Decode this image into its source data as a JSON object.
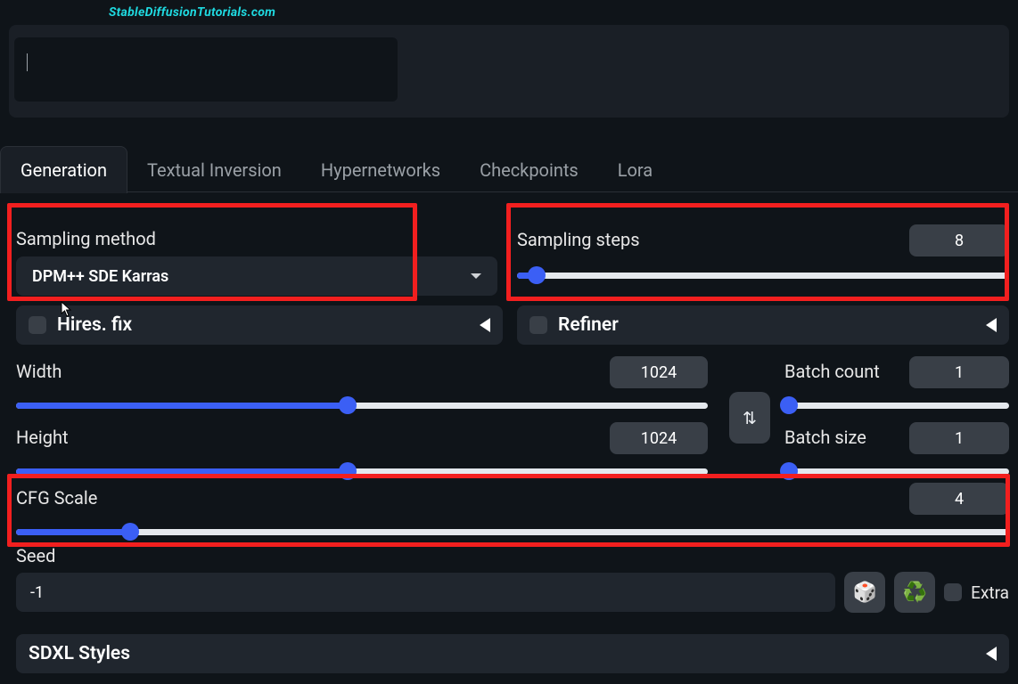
{
  "watermark": "StableDiffusionTutorials.com",
  "tabs": {
    "items": [
      {
        "label": "Generation",
        "active": true
      },
      {
        "label": "Textual Inversion",
        "active": false
      },
      {
        "label": "Hypernetworks",
        "active": false
      },
      {
        "label": "Checkpoints",
        "active": false
      },
      {
        "label": "Lora",
        "active": false
      }
    ]
  },
  "sampling_method": {
    "label": "Sampling method",
    "value": "DPM++ SDE Karras"
  },
  "sampling_steps": {
    "label": "Sampling steps",
    "value": 8,
    "min": 1,
    "max": 150,
    "fill_pct": 4
  },
  "hires_fix": {
    "label": "Hires. fix",
    "checked": false
  },
  "refiner": {
    "label": "Refiner",
    "checked": false
  },
  "width": {
    "label": "Width",
    "value": 1024,
    "min": 64,
    "max": 2048,
    "fill_pct": 48
  },
  "height": {
    "label": "Height",
    "value": 1024,
    "min": 64,
    "max": 2048,
    "fill_pct": 48
  },
  "swap_icon": "⇅",
  "batch_count": {
    "label": "Batch count",
    "value": 1,
    "fill_pct": 0
  },
  "batch_size": {
    "label": "Batch size",
    "value": 1,
    "fill_pct": 0
  },
  "cfg_scale": {
    "label": "CFG Scale",
    "value": 4,
    "min": 1,
    "max": 30,
    "fill_pct": 11.5
  },
  "seed": {
    "label": "Seed",
    "value": "-1"
  },
  "seed_random_icon": "🎲",
  "seed_reuse_icon": "♻️",
  "extra": {
    "label": "Extra",
    "checked": false
  },
  "sdxl_styles": {
    "label": "SDXL Styles"
  },
  "colors": {
    "accent": "#3b5ff5",
    "highlight_box": "#f21f1f",
    "panel": "#20262e",
    "numbox": "#393f47"
  }
}
